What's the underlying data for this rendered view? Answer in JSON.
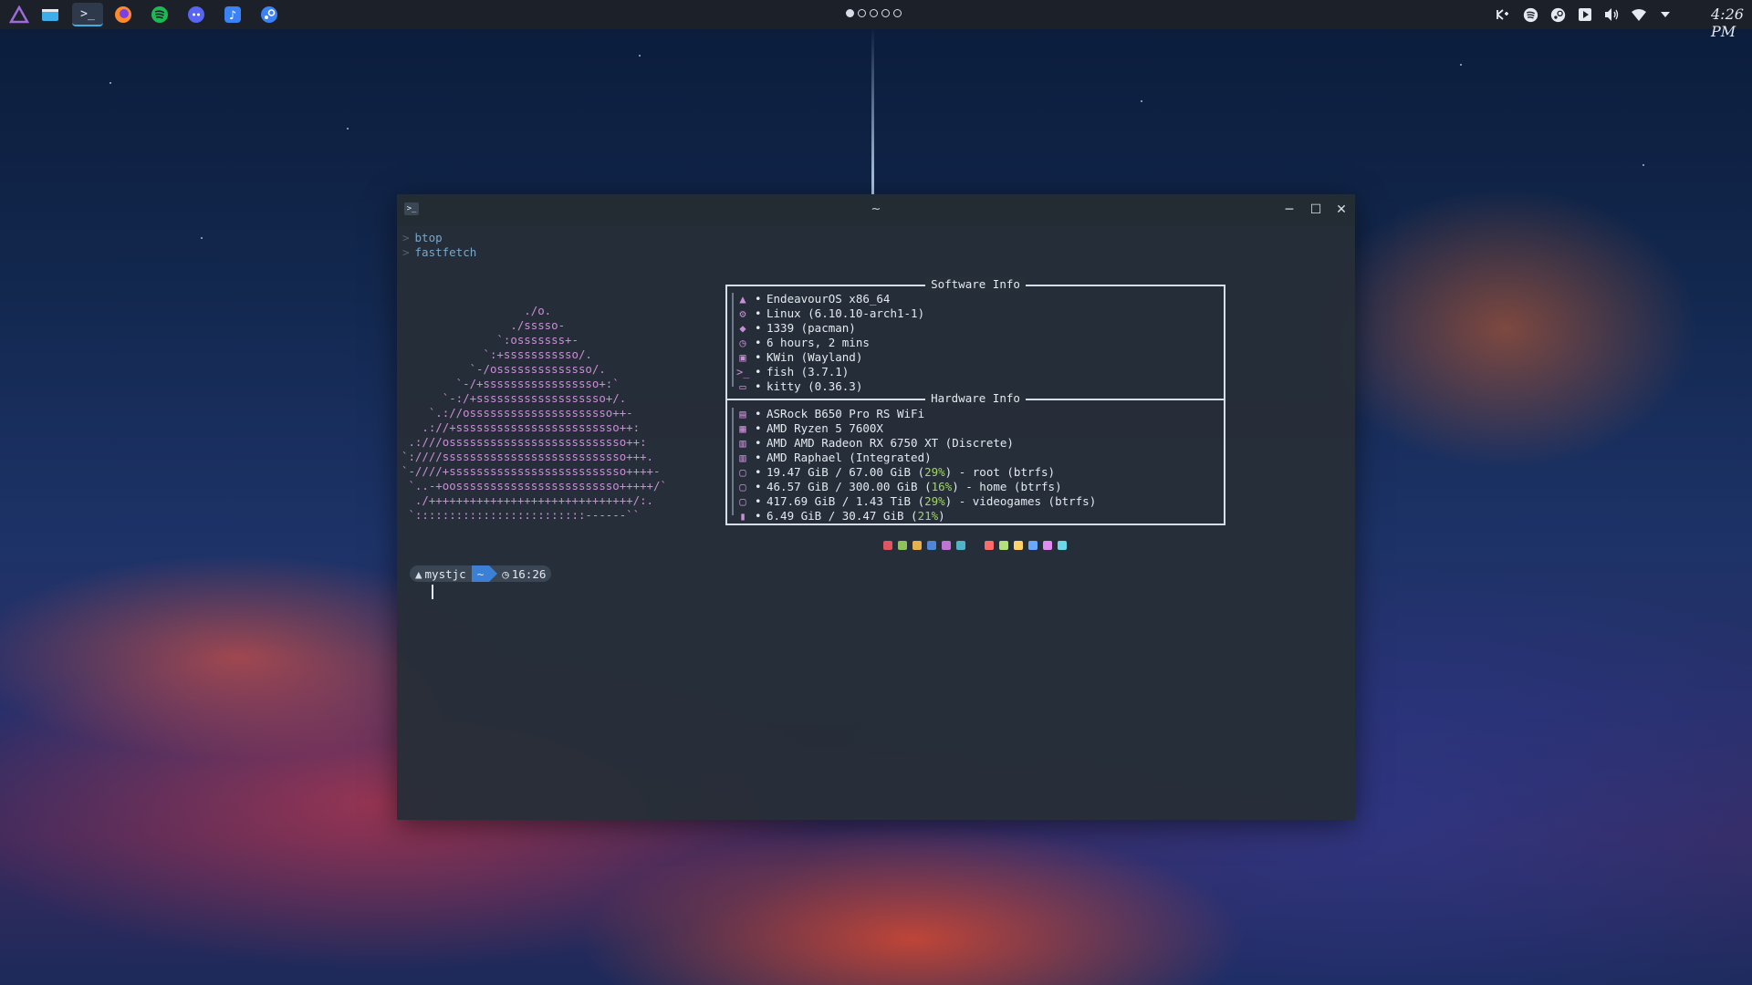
{
  "taskbar": {
    "apps": [
      {
        "name": "application-launcher",
        "color": "#9b6bd6"
      },
      {
        "name": "file-manager",
        "color": "#3daee9"
      },
      {
        "name": "terminal",
        "color": "#e5e9f0",
        "active": true
      },
      {
        "name": "firefox",
        "color": "#ff8a2b"
      },
      {
        "name": "spotify",
        "color": "#1db954"
      },
      {
        "name": "discord",
        "color": "#5865f2"
      },
      {
        "name": "music-app",
        "color": "#3b82f6"
      },
      {
        "name": "steam",
        "color": "#3b82f6"
      }
    ],
    "desktops": {
      "count": 5,
      "active": 1
    },
    "tray": [
      "kdeconnect",
      "spotify",
      "steam",
      "media",
      "volume",
      "wifi",
      "expand"
    ],
    "clock": "4:26 PM"
  },
  "window": {
    "title": "~",
    "history": [
      "btop",
      "fastfetch"
    ],
    "ascii_art": "                  ./o.\n                ./sssso-\n              `:osssssss+-\n            `:+sssssssssso/.\n          `-/ossssssssssssso/.\n        `-/+sssssssssssssssso+:`\n      `-:/+sssssssssssssssssso+/.\n    `.://osssssssssssssssssssso++-\n   .://+ssssssssssssssssssssssso++:\n .:///ossssssssssssssssssssssssso++:\n`:////sssssssssssssssssssssssssso+++.\n`-////+ssssssssssssssssssssssssso++++-\n `..-+oossssssssssssssssssssssso+++++/`\n  ./++++++++++++++++++++++++++++++/:.\n `:::::::::::::::::::::::::------``",
    "software": {
      "title": "Software Info",
      "rows": [
        {
          "icon": "distro-icon",
          "glyph": "▲",
          "text": "EndeavourOS x86_64"
        },
        {
          "icon": "kernel-icon",
          "glyph": "⚙",
          "text": "Linux (6.10.10-arch1-1)"
        },
        {
          "icon": "packages-icon",
          "glyph": "◆",
          "text": "1339 (pacman)"
        },
        {
          "icon": "uptime-icon",
          "glyph": "◷",
          "text": "6 hours, 2 mins"
        },
        {
          "icon": "wm-icon",
          "glyph": "▣",
          "text": "KWin (Wayland)"
        },
        {
          "icon": "shell-icon",
          "glyph": ">_",
          "text": "fish (3.7.1)"
        },
        {
          "icon": "terminal-icon",
          "glyph": "▭",
          "text": "kitty (0.36.3)"
        }
      ]
    },
    "hardware": {
      "title": "Hardware Info",
      "rows": [
        {
          "icon": "board-icon",
          "glyph": "▤",
          "pre": "ASRock B650 Pro RS WiFi",
          "pct": "",
          "post": ""
        },
        {
          "icon": "cpu-icon",
          "glyph": "▦",
          "pre": "AMD Ryzen 5 7600X",
          "pct": "",
          "post": ""
        },
        {
          "icon": "gpu-icon",
          "glyph": "▥",
          "pre": "AMD AMD Radeon RX 6750 XT (Discrete)",
          "pct": "",
          "post": ""
        },
        {
          "icon": "gpu-icon",
          "glyph": "▥",
          "pre": "AMD Raphael (Integrated)",
          "pct": "",
          "post": ""
        },
        {
          "icon": "disk-icon",
          "glyph": "▢",
          "pre": "19.47 GiB / 67.00 GiB (",
          "pct": "29%",
          "post": ") - root (btrfs)"
        },
        {
          "icon": "disk-icon",
          "glyph": "▢",
          "pre": "46.57 GiB / 300.00 GiB (",
          "pct": "16%",
          "post": ") - home (btrfs)"
        },
        {
          "icon": "disk-icon",
          "glyph": "▢",
          "pre": "417.69 GiB / 1.43 TiB (",
          "pct": "29%",
          "post": ") - videogames (btrfs)"
        },
        {
          "icon": "memory-icon",
          "glyph": "▮",
          "pre": "6.49 GiB / 30.47 GiB (",
          "pct": "21%",
          "post": ")"
        }
      ]
    },
    "palette": {
      "normal": [
        "#e0555f",
        "#8fc15c",
        "#e8b04a",
        "#4f86d6",
        "#c074d4",
        "#4fb4c7"
      ],
      "bright": [
        "#ff6a6a",
        "#b4e07a",
        "#ffd36a",
        "#6aa8ff",
        "#e08cf0",
        "#6ad8e8"
      ]
    },
    "prompt": {
      "user": "mystjc",
      "dir": "~",
      "time": "16:26"
    }
  }
}
